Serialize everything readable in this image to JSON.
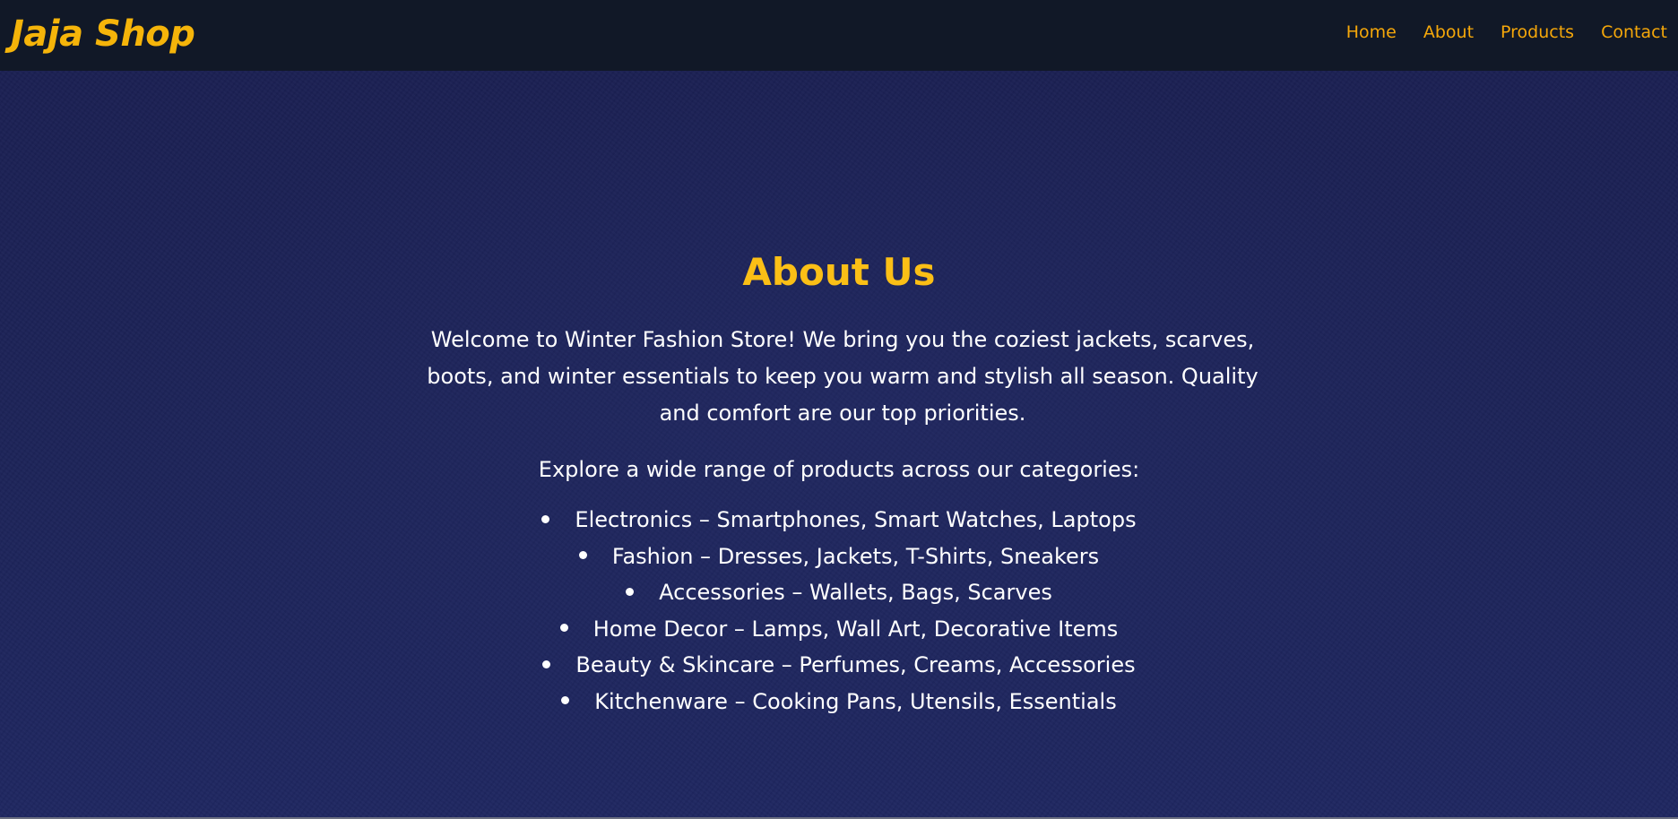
{
  "header": {
    "logo": "Jaja Shop",
    "nav": [
      {
        "label": "Home"
      },
      {
        "label": "About"
      },
      {
        "label": "Products"
      },
      {
        "label": "Contact"
      }
    ]
  },
  "about": {
    "title": "About Us",
    "intro": "Welcome to Winter Fashion Store! We bring you the coziest jackets, scarves, boots, and winter essentials to keep you warm and stylish all season. Quality and comfort are our top priorities.",
    "explore": "Explore a wide range of products across our categories:",
    "categories": [
      {
        "text": "Electronics – Smartphones, Smart Watches, Laptops"
      },
      {
        "text": "Fashion – Dresses, Jackets, T-Shirts, Sneakers"
      },
      {
        "text": "Accessories – Wallets, Bags, Scarves"
      },
      {
        "text": "Home Decor – Lamps, Wall Art, Decorative Items"
      },
      {
        "text": "Beauty & Skincare – Perfumes, Creams, Accessories"
      },
      {
        "text": "Kitchenware – Cooking Pans, Utensils, Essentials"
      }
    ]
  },
  "colors": {
    "navbar_bg": "#111827",
    "accent": "#f5b40a",
    "hero_bg": "#1d2459",
    "text": "#ffffff"
  }
}
